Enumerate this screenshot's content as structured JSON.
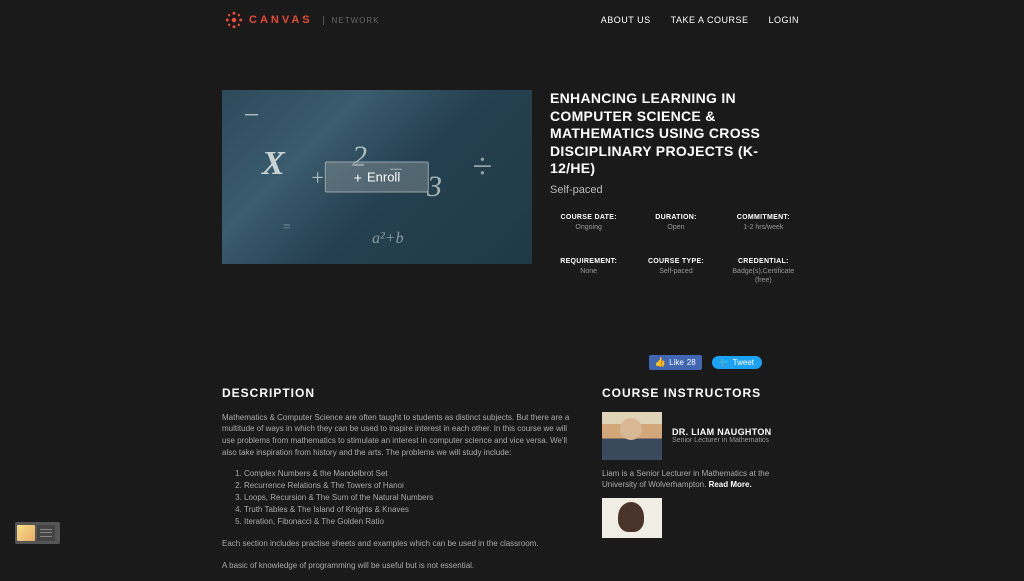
{
  "header": {
    "brand": "CANVAS",
    "brand_sub": "NETWORK",
    "nav": {
      "about": "ABOUT US",
      "take_course": "TAKE A COURSE",
      "login": "LOGIN"
    }
  },
  "hero": {
    "enroll_label": "Enroll",
    "title": "ENHANCING LEARNING IN COMPUTER SCIENCE & MATHEMATICS USING CROSS DISCIPLINARY PROJECTS (K-12/HE)",
    "pace": "Self-paced",
    "meta": {
      "date_label": "COURSE DATE:",
      "date_value": "Ongoing",
      "duration_label": "DURATION:",
      "duration_value": "Open",
      "commitment_label": "COMMITMENT:",
      "commitment_value": "1-2 hrs/week",
      "requirement_label": "REQUIREMENT:",
      "requirement_value": "None",
      "type_label": "COURSE TYPE:",
      "type_value": "Self-paced",
      "credential_label": "CREDENTIAL:",
      "credential_value": "Badge(s),Certificate (free)"
    }
  },
  "social": {
    "fb_label": "Like",
    "fb_count": "28",
    "tweet_label": "Tweet"
  },
  "description": {
    "heading": "DESCRIPTION",
    "intro": "Mathematics & Computer Science are often taught to students as distinct subjects. But there are a multitude of ways in which they can be used to inspire interest in each other. In this course we will use problems from mathematics to stimulate an interest in computer science and vice versa. We'll also take inspiration from history and the arts. The problems we will study include:",
    "topics": [
      "Complex Numbers & the Mandelbrot Set",
      "Recurrence Relations & The Towers of Hanoi",
      "Loops, Recursion & The Sum of the Natural Numbers",
      "Truth Tables & The Island of Knights & Knaves",
      "Iteration, Fibonacci & The Golden Ratio"
    ],
    "after1": "Each section includes practise sheets and examples which can be used in the classroom.",
    "after2": "A basic of knowledge of programming will be useful but is not essential."
  },
  "instructors": {
    "heading": "COURSE INSTRUCTORS",
    "first": {
      "name": "DR. LIAM NAUGHTON",
      "role": "Senior Lecturer in Mathematics",
      "bio_prefix": "Liam is a Senior Lecturer in Mathematics at the University of Wolverhampton. ",
      "read_more": "Read More."
    }
  }
}
